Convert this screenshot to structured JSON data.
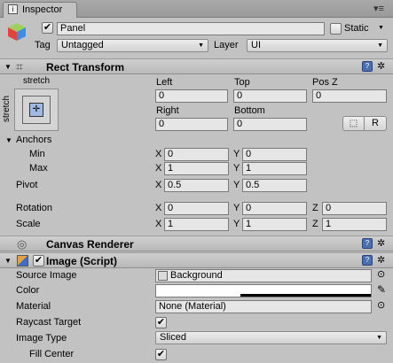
{
  "window": {
    "tab_title": "Inspector"
  },
  "object": {
    "name": "Panel",
    "static_label": "Static",
    "tag_label": "Tag",
    "tag_value": "Untagged",
    "layer_label": "Layer",
    "layer_value": "UI"
  },
  "rect_transform": {
    "title": "Rect Transform",
    "anchor_preset_top": "stretch",
    "anchor_preset_side": "stretch",
    "left_label": "Left",
    "left_value": "0",
    "top_label": "Top",
    "top_value": "0",
    "posz_label": "Pos Z",
    "posz_value": "0",
    "right_label": "Right",
    "right_value": "0",
    "bottom_label": "Bottom",
    "bottom_value": "0",
    "raw_button": "R",
    "anchors_label": "Anchors",
    "min_label": "Min",
    "min_x": "0",
    "min_y": "0",
    "max_label": "Max",
    "max_x": "1",
    "max_y": "1",
    "pivot_label": "Pivot",
    "pivot_x": "0.5",
    "pivot_y": "0.5",
    "rotation_label": "Rotation",
    "rot_x": "0",
    "rot_y": "0",
    "rot_z": "0",
    "scale_label": "Scale",
    "scale_x": "1",
    "scale_y": "1",
    "scale_z": "1",
    "x": "X",
    "y": "Y",
    "z": "Z"
  },
  "canvas_renderer": {
    "title": "Canvas Renderer"
  },
  "image": {
    "title": "Image (Script)",
    "source_image_label": "Source Image",
    "source_image_value": "Background",
    "color_label": "Color",
    "material_label": "Material",
    "material_value": "None (Material)",
    "raycast_label": "Raycast Target",
    "image_type_label": "Image Type",
    "image_type_value": "Sliced",
    "fill_center_label": "Fill Center"
  },
  "colors": {
    "background": "#c2c2c2",
    "field": "#e6e6e6",
    "help": "#4a6fb0"
  }
}
